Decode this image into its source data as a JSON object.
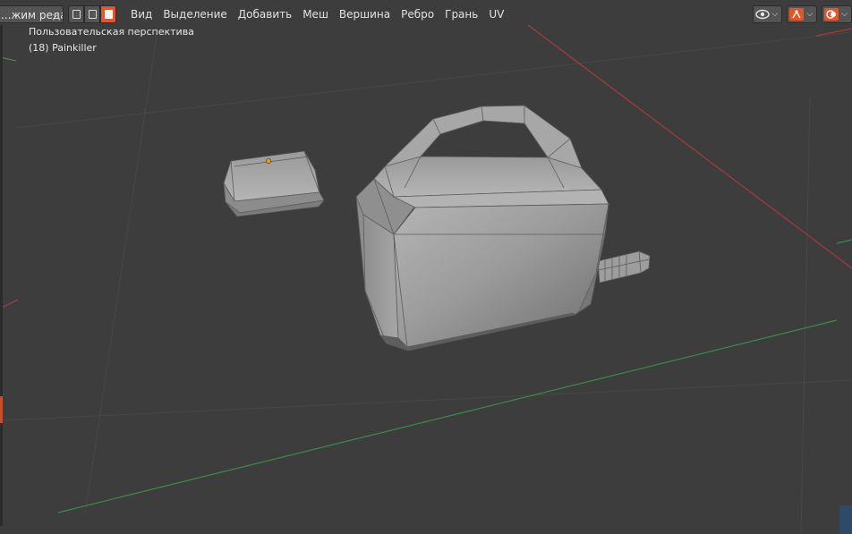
{
  "header": {
    "mode_label": "...жим реда...",
    "menu": [
      "Вид",
      "Выделение",
      "Добавить",
      "Меш",
      "Вершина",
      "Ребро",
      "Грань",
      "UV"
    ]
  },
  "overlay": {
    "view_name": "Пользовательская перспектива",
    "object_name": "(18) Painkiller"
  },
  "icons": {
    "mode_dropdown": "chevron-down-icon",
    "select_vertex": "vertex-select-icon",
    "select_edge": "edge-select-icon",
    "select_face": "face-select-icon",
    "visibility": "eye-icon",
    "gizmo": "gizmo-icon",
    "overlays": "overlays-icon"
  },
  "colors": {
    "viewport_bg": "#3d3d3d",
    "accent": "#e0572b",
    "x_axis": "#a83a3a",
    "y_axis": "#3d8a4a",
    "grid": "#4a4a4a",
    "mesh": "#8a8a8a"
  }
}
